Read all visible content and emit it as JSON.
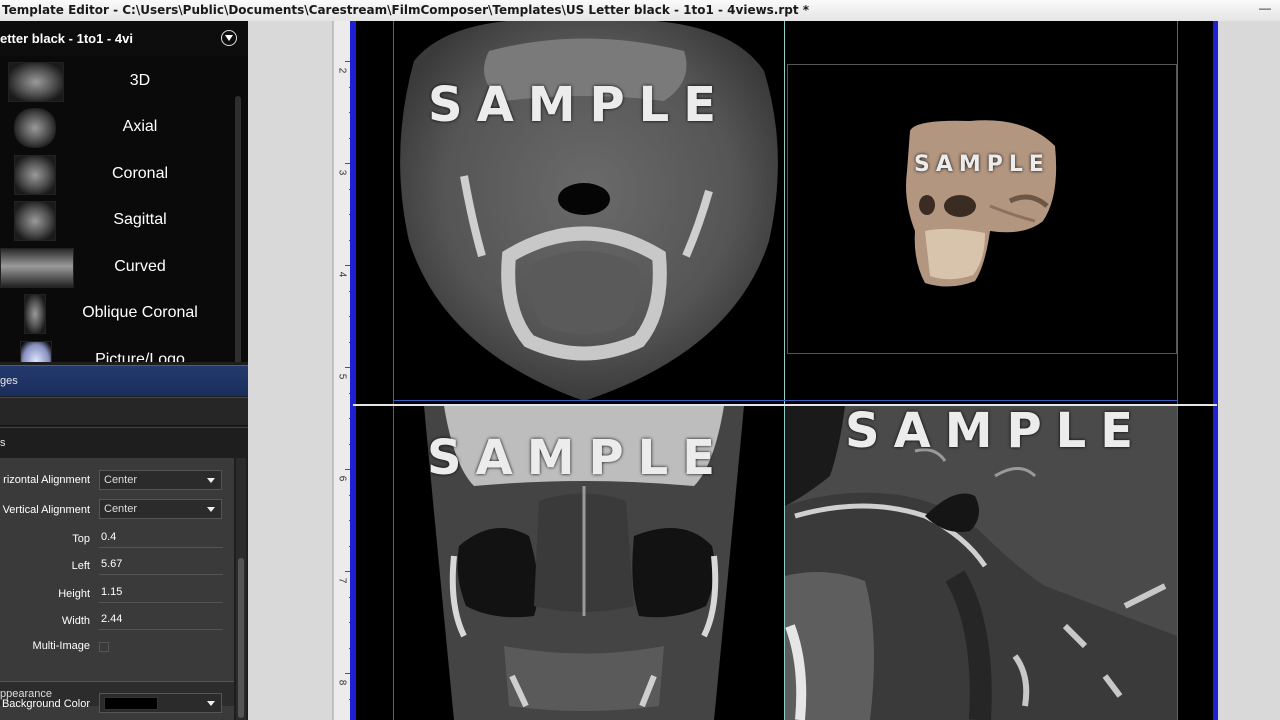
{
  "window": {
    "title": "Template Editor - C:\\Users\\Public\\Documents\\Carestream\\FilmComposer\\Templates\\US Letter black - 1to1 - 4views.rpt *"
  },
  "gallery": {
    "title": "etter black - 1to1 - 4vi",
    "items": [
      {
        "label": "3D",
        "icon": "skull-3d-thumbnail-icon"
      },
      {
        "label": "Axial",
        "icon": "axial-slice-thumbnail-icon"
      },
      {
        "label": "Coronal",
        "icon": "coronal-slice-thumbnail-icon"
      },
      {
        "label": "Sagittal",
        "icon": "sagittal-slice-thumbnail-icon"
      },
      {
        "label": "Curved",
        "icon": "panoramic-thumbnail-icon"
      },
      {
        "label": "Oblique Coronal",
        "icon": "oblique-slice-thumbnail-icon"
      },
      {
        "label": "Picture/Logo",
        "icon": "picture-thumbnail-icon"
      }
    ]
  },
  "sections": {
    "images": "ges",
    "properties": "s",
    "appearance": "ppearance"
  },
  "properties": {
    "horizontal_alignment": {
      "label": "rizontal Alignment",
      "value": "Center"
    },
    "vertical_alignment": {
      "label": "Vertical Alignment",
      "value": "Center"
    },
    "top": {
      "label": "Top",
      "value": "0.4"
    },
    "left": {
      "label": "Left",
      "value": "5.67"
    },
    "height": {
      "label": "Height",
      "value": "1.15"
    },
    "width": {
      "label": "Width",
      "value": "2.44"
    },
    "multi_image": {
      "label": "Multi-Image"
    },
    "background_color": {
      "label": "Background Color",
      "color": "#000000"
    }
  },
  "ruler": {
    "numbers": [
      "2",
      "3",
      "4",
      "5",
      "6",
      "7",
      "8"
    ]
  },
  "views": {
    "axial_watermark": "SAMPLE",
    "threed_watermark": "SAMPLE",
    "coronal_watermark": "SAMPLE",
    "sagittal_watermark": "SAMPLE"
  },
  "colors": {
    "page_background": "#000000",
    "page_border": "#1f1fd6",
    "margin_guide": "#d03030",
    "section_highlight": "#243a6e"
  }
}
